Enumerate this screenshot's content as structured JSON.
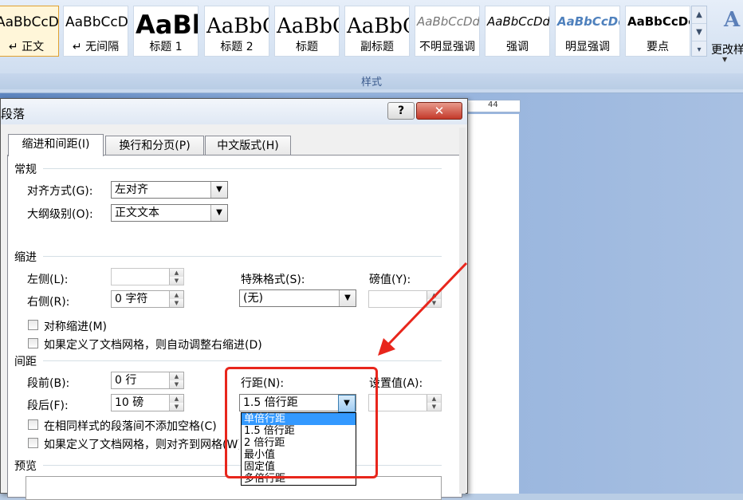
{
  "ribbon": {
    "styles": [
      {
        "preview": "AaBbCcDc",
        "name": "正文",
        "mark": "↵",
        "selected": true
      },
      {
        "preview": "AaBbCcDc",
        "name": "无间隔",
        "mark": "↵"
      },
      {
        "preview": "AaBl",
        "name": "标题 1"
      },
      {
        "preview": "AaBbC",
        "name": "标题 2"
      },
      {
        "preview": "AaBbC",
        "name": "标题"
      },
      {
        "preview": "AaBbC",
        "name": "副标题"
      },
      {
        "preview": "AaBbCcDd",
        "name": "不明显强调"
      },
      {
        "preview": "AaBbCcDd",
        "name": "强调"
      },
      {
        "preview": "AaBbCcDd",
        "name": "明显强调"
      },
      {
        "preview": "AaBbCcDc",
        "name": "要点"
      }
    ],
    "change_styles_label": "更改样",
    "group_label": "样式"
  },
  "ruler": {
    "mark": "44"
  },
  "dialog": {
    "title": "段落",
    "help": "?",
    "close": "✕",
    "tabs": [
      "缩进和间距(I)",
      "换行和分页(P)",
      "中文版式(H)"
    ],
    "general": {
      "title": "常规",
      "alignment_label": "对齐方式(G):",
      "alignment_value": "左对齐",
      "outline_label": "大纲级别(O):",
      "outline_value": "正文文本"
    },
    "indent": {
      "title": "缩进",
      "left_label": "左侧(L):",
      "left_value": "",
      "right_label": "右侧(R):",
      "right_value": "0 字符",
      "special_label": "特殊格式(S):",
      "special_value": "(无)",
      "by_label": "磅值(Y):",
      "by_value": "",
      "mirror_label": "对称缩进(M)",
      "auto_adjust_label": "如果定义了文档网格，则自动调整右缩进(D)"
    },
    "spacing": {
      "title": "间距",
      "before_label": "段前(B):",
      "before_value": "0 行",
      "after_label": "段后(F):",
      "after_value": "10 磅",
      "line_label": "行距(N):",
      "line_value": "1.5 倍行距",
      "at_label": "设置值(A):",
      "at_value": "",
      "no_space_label": "在相同样式的段落间不添加空格(C)",
      "snap_grid_label": "如果定义了文档网格，则对齐到网格(W)"
    },
    "line_spacing_options": [
      "单倍行距",
      "1.5 倍行距",
      "2 倍行距",
      "最小值",
      "固定值",
      "多倍行距"
    ],
    "highlighted_option": 0,
    "preview": {
      "title": "预览"
    }
  },
  "colors": {
    "annotation": "#e8261c",
    "highlight": "#3399ff"
  }
}
